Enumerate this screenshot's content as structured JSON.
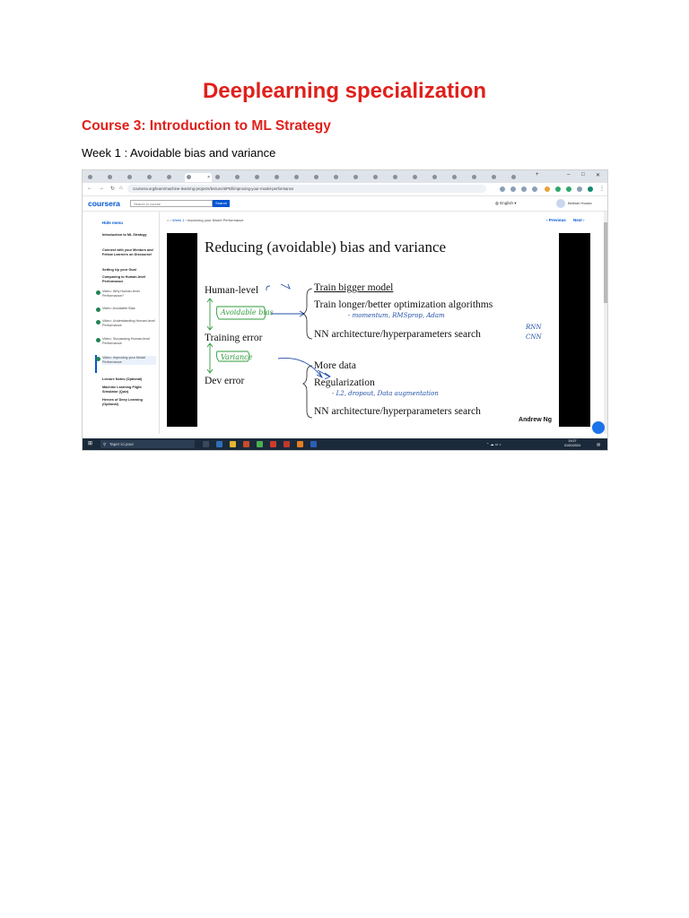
{
  "document": {
    "title": "Deeplearning specialization",
    "course_heading": "Course 3: Introduction to ML Strategy",
    "week_line": "Week 1 : Avoidable bias and variance"
  },
  "browser": {
    "active_tab_close": "×",
    "new_tab": "+",
    "url": "coursera.org/learn/machine-learning-projects/lecture/4iPDl/improving-your-model-performance"
  },
  "coursera": {
    "logo": "coursera",
    "search_placeholder": "Search in course",
    "search_button": "Search",
    "language": "English",
    "user_name": "Betinah Houria"
  },
  "sidebar": {
    "hide_menu": "Hide menu",
    "items": [
      "Introduction to ML Strategy",
      "Connect with your Mentors and Fellow Learners on Discourse!",
      "Setting Up your Goal",
      "Comparing to Human-level Performance",
      "Video: Why Human-level Performance?",
      "Video: Avoidable Bias",
      "Video: Understanding Human-level Performance",
      "Video: Surpassing Human-level Performance",
      "Video: Improving your Model Performance",
      "Lecture Notes (Optional)",
      "Machine Learning Flight Simulator (Quiz)",
      "Heroes of Deep Learning (Optional)"
    ]
  },
  "breadcrumb": {
    "week": "Week 1",
    "page": "Improving your Model Performance"
  },
  "nav": {
    "previous": "Previous",
    "next": "Next"
  },
  "slide": {
    "title": "Reducing (avoidable) bias and variance",
    "human_level": "Human-level",
    "training_error": "Training error",
    "dev_error": "Dev error",
    "avoidable_bias_note": "Avoidable bias",
    "variance_note": "Variance",
    "bias_fixes": [
      "Train bigger model",
      "Train longer/better optimization algorithms",
      "NN architecture/hyperparameters search"
    ],
    "optim_note": "- momentum, RMSprop, Adam",
    "arch_note_1": "RNN",
    "arch_note_2": "CNN",
    "variance_fixes": [
      "More data",
      "Regularization",
      "NN architecture/hyperparameters search"
    ],
    "reg_note": "- L2, dropout, Data augmentation",
    "credit": "Andrew Ng"
  },
  "taskbar": {
    "search_text": "Taper ici pour",
    "time": "19:27",
    "date": "01/01/2024"
  },
  "colors": {
    "title_red": "#e0201b",
    "coursera_blue": "#0056d2",
    "handwriting_green": "#2e9b3a",
    "handwriting_blue": "#2350a8",
    "taskbar": "#1b2a3a"
  }
}
